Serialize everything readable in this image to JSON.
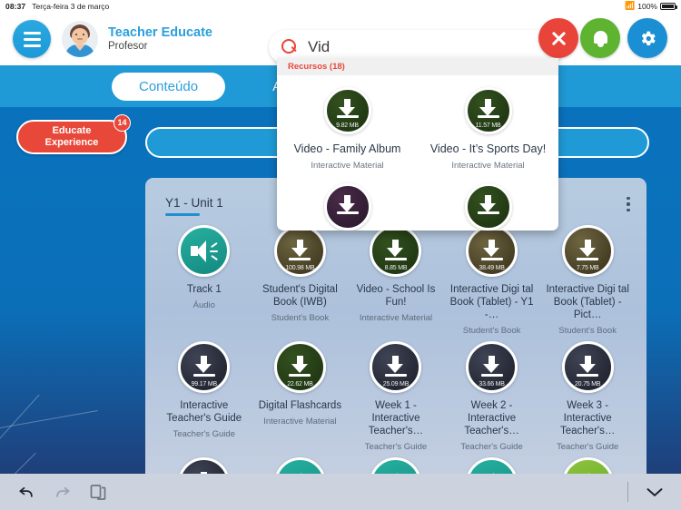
{
  "statusbar": {
    "time": "08:37",
    "date": "Terça-feira 3 de março",
    "wifi_icon": "wifi-icon",
    "battery_percent": "100%"
  },
  "header": {
    "menu_icon": "hamburger-menu-icon",
    "avatar_icon": "user-avatar",
    "user_name": "Teacher Educate",
    "user_role": "Profesor"
  },
  "search": {
    "icon": "search-icon",
    "value": "Vid",
    "placeholder": "",
    "clear_icon": "close-icon",
    "bell_icon": "bell-icon",
    "gear_icon": "gear-icon"
  },
  "tabs": [
    {
      "label": "Conteúdo",
      "active": true
    },
    {
      "label": "Ativi",
      "active": false
    }
  ],
  "educate": {
    "line1": "Educate",
    "line2": "Experience",
    "badge": "14",
    "color": "#e8483a"
  },
  "panel": {
    "title": "Y1 - Unit 1",
    "kebab_icon": "more-options-icon",
    "items": [
      {
        "title": "Track 1",
        "subtitle": "Áudio",
        "size": "",
        "kind": "audio",
        "tile": "t-teal"
      },
      {
        "title": "Student's Digital Book (IWB)",
        "subtitle": "Student's Book",
        "size": "100.98 MB",
        "kind": "download",
        "tile": "t-olive"
      },
      {
        "title": "Video - School Is Fun!",
        "subtitle": "Interactive Material",
        "size": "8.85 MB",
        "kind": "download",
        "tile": "t-green"
      },
      {
        "title": "Interactive Digi tal Book (Tablet) - Y1 -…",
        "subtitle": "Student's Book",
        "size": "38.49 MB",
        "kind": "download",
        "tile": "t-olive"
      },
      {
        "title": "Interactive Digi tal Book (Tablet) - Pict…",
        "subtitle": "Student's Book",
        "size": "7.75 MB",
        "kind": "download",
        "tile": "t-olive"
      },
      {
        "title": "Interactive Teacher's Guide",
        "subtitle": "Teacher's Guide",
        "size": "99.17 MB",
        "kind": "download",
        "tile": "t-dark"
      },
      {
        "title": "Digital Flashcards",
        "subtitle": "Interactive Material",
        "size": "22.62 MB",
        "kind": "download",
        "tile": "t-green"
      },
      {
        "title": "Week 1 - Interactive Teacher's…",
        "subtitle": "Teacher's Guide",
        "size": "25.09 MB",
        "kind": "download",
        "tile": "t-dark"
      },
      {
        "title": "Week 2 - Interactive Teacher's…",
        "subtitle": "Teacher's Guide",
        "size": "33.66 MB",
        "kind": "download",
        "tile": "t-dark"
      },
      {
        "title": "Week 3 - Interactive Teacher's…",
        "subtitle": "Teacher's Guide",
        "size": "20.75 MB",
        "kind": "download",
        "tile": "t-dark"
      }
    ],
    "partial_row_tiles": [
      "t-dark",
      "t-teal",
      "t-teal",
      "t-teal",
      "t-lime"
    ]
  },
  "dropdown": {
    "section_label": "Recursos (18)",
    "results": [
      {
        "title": "Video - Family Album",
        "subtitle": "Interactive Material",
        "size": "9.82 MB",
        "tile": "t-green"
      },
      {
        "title": "Video - It’s Sports Day!",
        "subtitle": "Interactive Material",
        "size": "11.57 MB",
        "tile": "t-green"
      }
    ],
    "clipped_row_tiles": [
      "t-purple",
      "t-green"
    ]
  },
  "toolbar": {
    "undo_icon": "undo-icon",
    "redo_icon": "redo-icon",
    "copy_icon": "copy-icon",
    "dismiss_icon": "chevron-down-icon"
  }
}
